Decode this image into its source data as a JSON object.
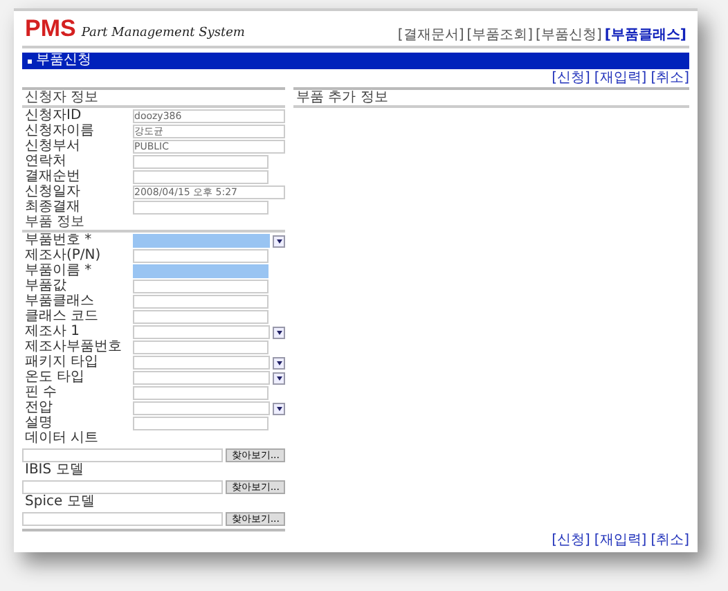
{
  "header": {
    "logo": "PMS",
    "subtitle": "Part Management System",
    "links": [
      {
        "label": "[결재문서]",
        "selected": false
      },
      {
        "label": "[부품조회]",
        "selected": false
      },
      {
        "label": "[부품신청]",
        "selected": false
      },
      {
        "label": "[부품클래스]",
        "selected": true
      }
    ]
  },
  "title_bar": {
    "title": "부품신청"
  },
  "actions_top": [
    "[신청]",
    "[재입력]",
    "[취소]"
  ],
  "applicant_section": {
    "title": "신청자 정보",
    "fields": [
      {
        "label": "신청자ID",
        "kind": "text",
        "value": "doozy386"
      },
      {
        "label": "신청자이름",
        "kind": "text",
        "value": "강도균"
      },
      {
        "label": "신청부서",
        "kind": "text",
        "value": "PUBLIC"
      },
      {
        "label": "연락처",
        "kind": "input"
      },
      {
        "label": "결재순번",
        "kind": "input"
      },
      {
        "label": "신청일자",
        "kind": "text",
        "value": "2008/04/15 오후 5:27"
      },
      {
        "label": "최종결재",
        "kind": "input"
      }
    ]
  },
  "part_section": {
    "title": "부품 정보",
    "fields": [
      {
        "label": "부품번호 *",
        "kind": "select",
        "required": true
      },
      {
        "label": "제조사(P/N)",
        "kind": "input",
        "required": false
      },
      {
        "label": "부품이름 *",
        "kind": "input",
        "required": true
      },
      {
        "label": "부품값",
        "kind": "input",
        "required": false
      },
      {
        "label": "부품클래스",
        "kind": "input",
        "required": false
      },
      {
        "label": "클래스 코드",
        "kind": "input",
        "required": false
      },
      {
        "label": "제조사 1",
        "kind": "select",
        "required": false
      },
      {
        "label": "제조사부품번호",
        "kind": "input",
        "required": false
      },
      {
        "label": "패키지 타입",
        "kind": "select",
        "required": false
      },
      {
        "label": "온도 타입",
        "kind": "select",
        "required": false
      },
      {
        "label": "핀 수",
        "kind": "input",
        "required": false
      },
      {
        "label": "전압",
        "kind": "select",
        "required": false
      },
      {
        "label": "설명",
        "kind": "input",
        "required": false
      },
      {
        "label": "데이터 시트",
        "kind": "file",
        "button": "찾아보기..."
      },
      {
        "label": "IBIS 모델",
        "kind": "file",
        "button": "찾아보기..."
      },
      {
        "label": "Spice 모델",
        "kind": "file",
        "button": "찾아보기..."
      }
    ]
  },
  "extra_section": {
    "title": "부품 추가 정보"
  },
  "actions_bottom": [
    "[신청]",
    "[재입력]",
    "[취소]"
  ]
}
